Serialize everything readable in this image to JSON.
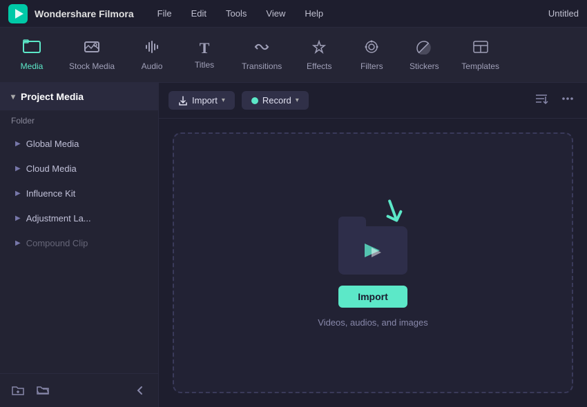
{
  "titlebar": {
    "appname": "Wondershare Filmora",
    "menu": [
      "File",
      "Edit",
      "Tools",
      "View",
      "Help"
    ],
    "project_name": "Untitled"
  },
  "toolbar": {
    "tabs": [
      {
        "id": "media",
        "label": "Media",
        "icon": "🎞",
        "active": true
      },
      {
        "id": "stock-media",
        "label": "Stock Media",
        "icon": "📁"
      },
      {
        "id": "audio",
        "label": "Audio",
        "icon": "🎵"
      },
      {
        "id": "titles",
        "label": "Titles",
        "icon": "T"
      },
      {
        "id": "transitions",
        "label": "Transitions",
        "icon": "↔"
      },
      {
        "id": "effects",
        "label": "Effects",
        "icon": "✨"
      },
      {
        "id": "filters",
        "label": "Filters",
        "icon": "🎨"
      },
      {
        "id": "stickers",
        "label": "Stickers",
        "icon": "🔖"
      },
      {
        "id": "templates",
        "label": "Templates",
        "icon": "⬛"
      }
    ]
  },
  "sidebar": {
    "header_label": "Project Media",
    "folder_section_label": "Folder",
    "items": [
      {
        "id": "global-media",
        "label": "Global Media"
      },
      {
        "id": "cloud-media",
        "label": "Cloud Media"
      },
      {
        "id": "influence-kit",
        "label": "Influence Kit"
      },
      {
        "id": "adjustment-layer",
        "label": "Adjustment La..."
      },
      {
        "id": "compound-clip",
        "label": "Compound Clip"
      }
    ],
    "footer": {
      "new_folder_btn": "🗀",
      "open_folder_btn": "🗁",
      "collapse_btn": "❮"
    }
  },
  "content": {
    "import_label": "Import",
    "record_label": "Record",
    "filter_icon": "filter",
    "more_icon": "more",
    "dropzone": {
      "import_btn_label": "Import",
      "hint": "Videos, audios, and images"
    }
  }
}
